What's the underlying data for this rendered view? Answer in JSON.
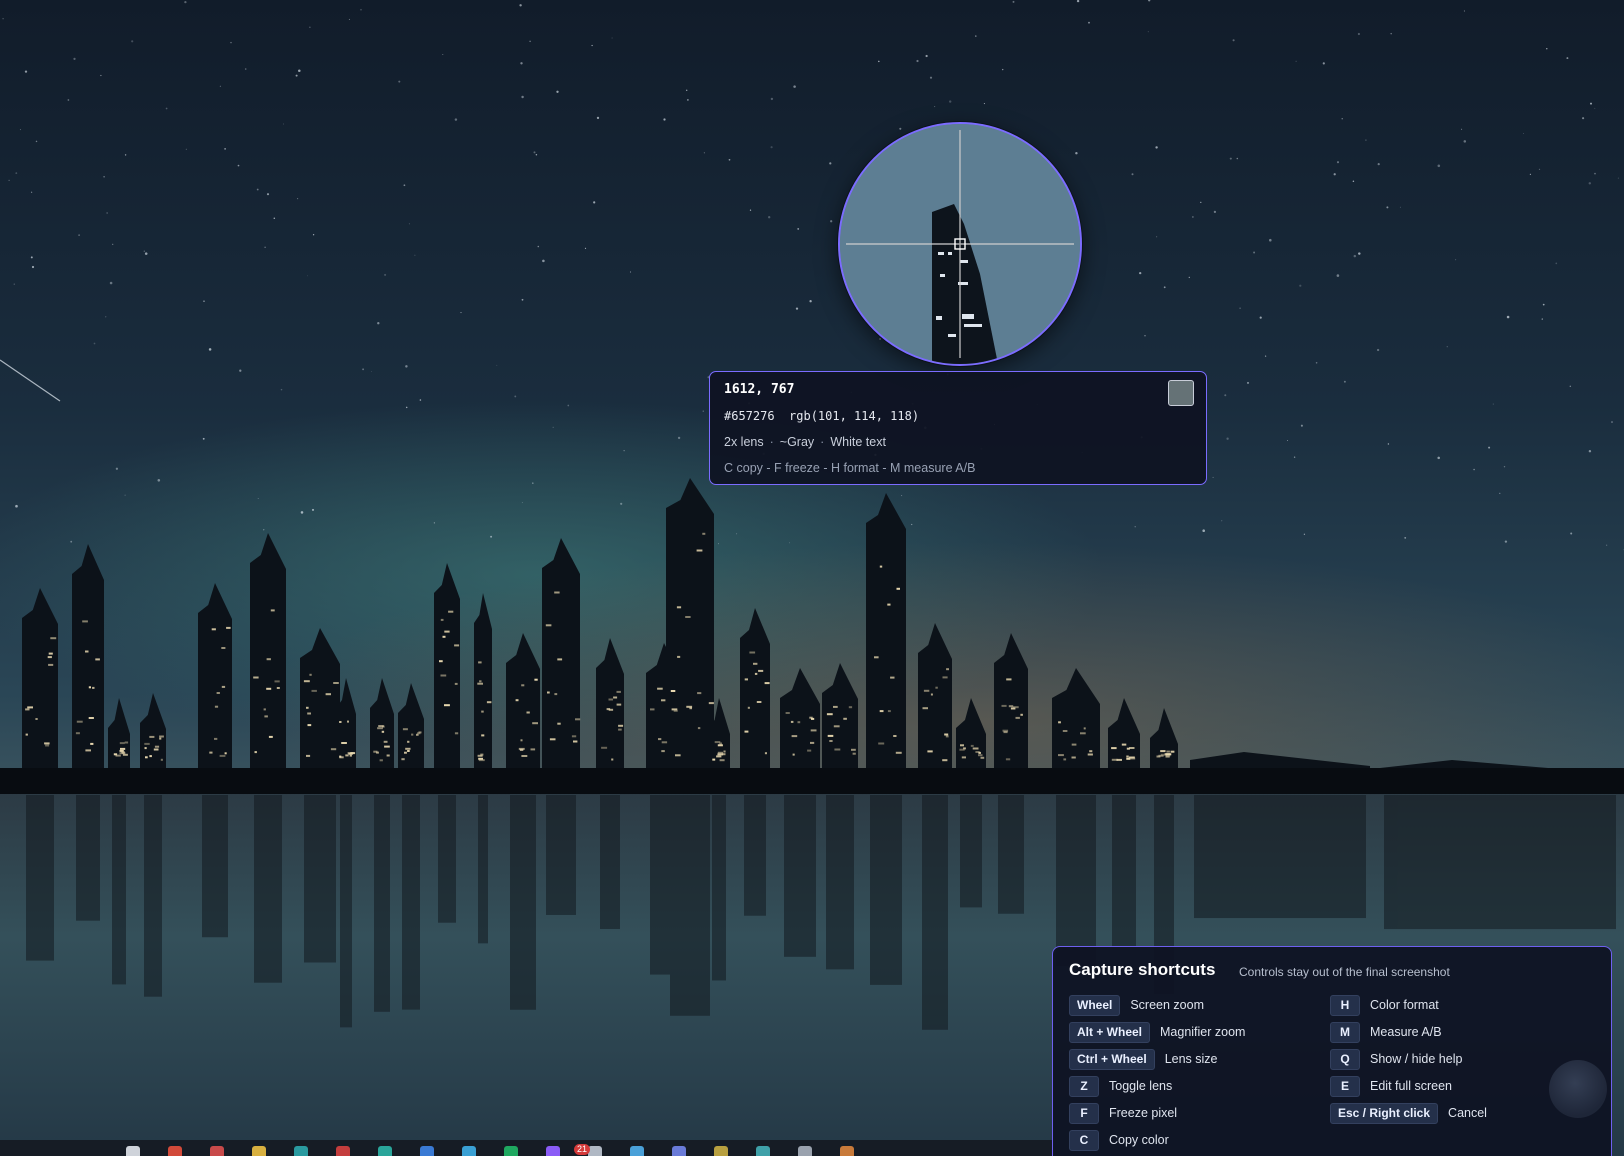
{
  "picker": {
    "coordinates": "1612, 767",
    "hex": "#657276",
    "rgb": "rgb(101, 114, 118)",
    "lens": "2x lens",
    "color_name": "~Gray",
    "text_suggestion": "White text",
    "meta_separator": "·",
    "hint": "C copy - F freeze - H format - M measure A/B",
    "swatch_color": "#657276",
    "accent_color": "#7b6cff"
  },
  "shortcuts": {
    "title": "Capture shortcuts",
    "subtitle": "Controls stay out of the final screenshot",
    "left": [
      {
        "key": "Wheel",
        "label": "Screen zoom"
      },
      {
        "key": "Alt + Wheel",
        "label": "Magnifier zoom"
      },
      {
        "key": "Ctrl + Wheel",
        "label": "Lens size"
      },
      {
        "key": "Z",
        "label": "Toggle lens"
      },
      {
        "key": "F",
        "label": "Freeze pixel"
      },
      {
        "key": "C",
        "label": "Copy color"
      }
    ],
    "right": [
      {
        "key": "H",
        "label": "Color format"
      },
      {
        "key": "M",
        "label": "Measure A/B"
      },
      {
        "key": "Q",
        "label": "Show / hide help"
      },
      {
        "key": "E",
        "label": "Edit full screen"
      },
      {
        "key": "Esc / Right click",
        "label": "Cancel"
      }
    ]
  },
  "taskbar": {
    "badge": "21",
    "icons": [
      "start-icon",
      "browser-icon",
      "calendar-icon",
      "files-icon",
      "edge-icon",
      "chrome-icon",
      "teams-icon",
      "mail-icon",
      "store-icon",
      "sheets-icon",
      "chat-icon",
      "cloud-icon",
      "settings-icon",
      "notes-icon",
      "photos-icon",
      "terminal-icon",
      "maps-icon",
      "vpn-icon"
    ]
  }
}
